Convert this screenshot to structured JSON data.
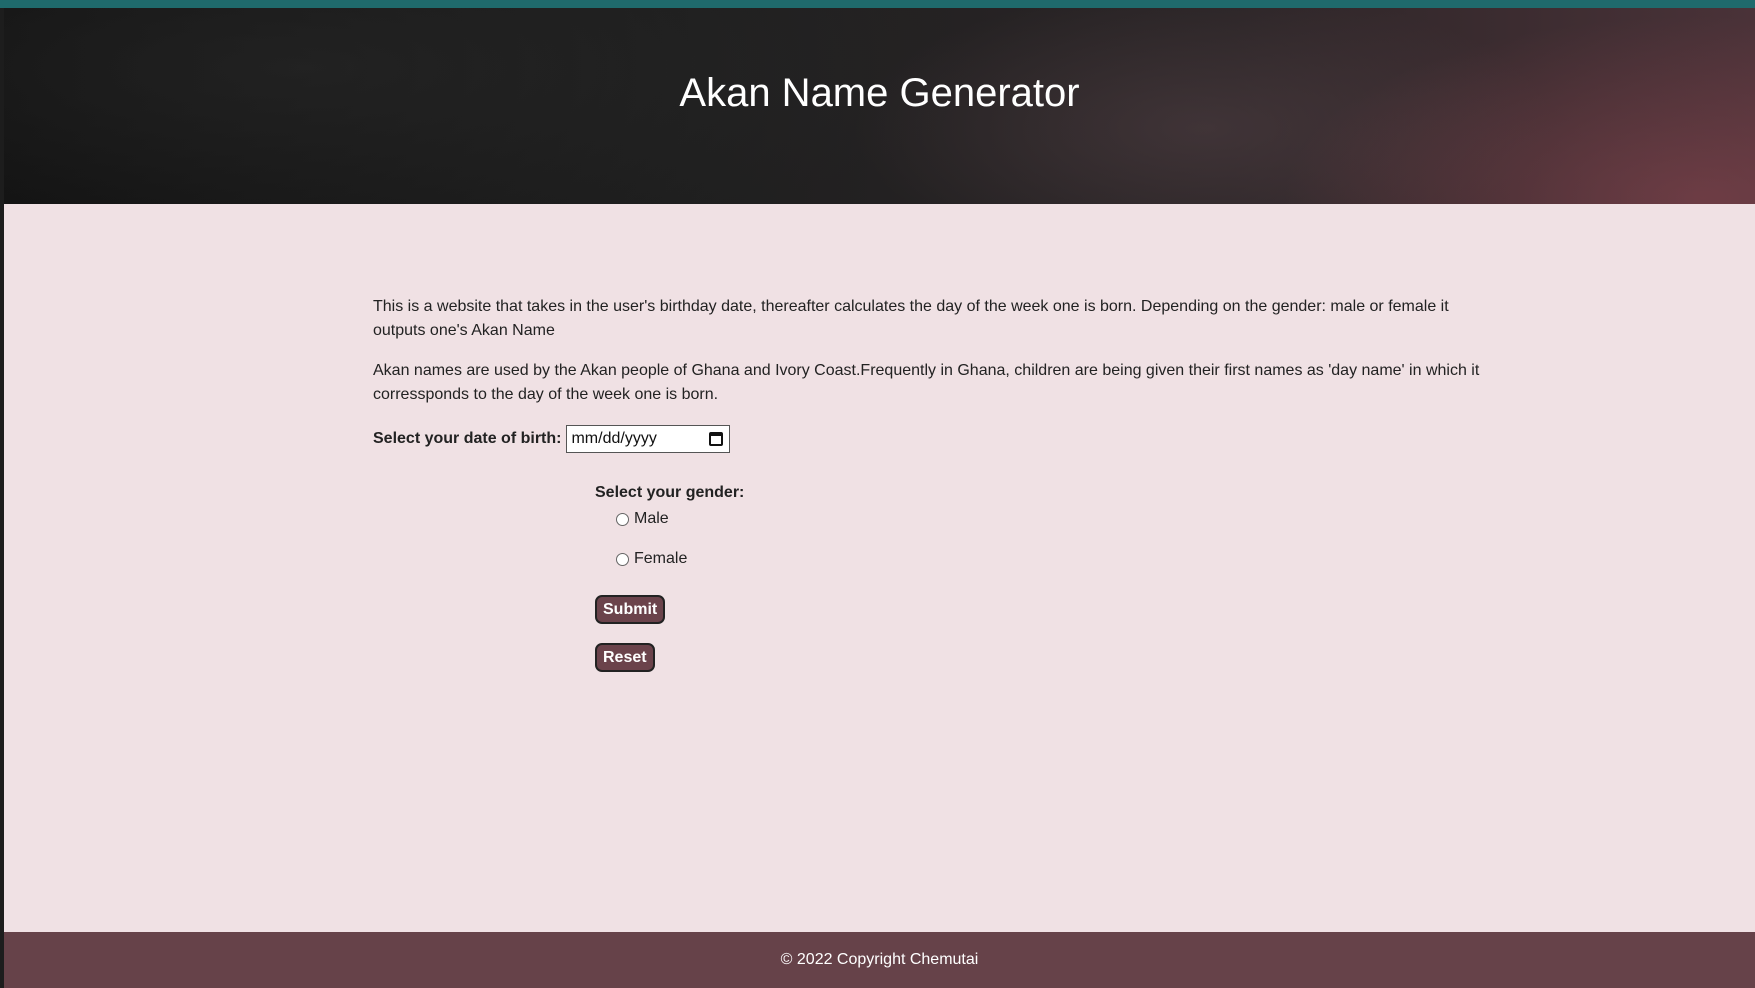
{
  "header": {
    "title": "Akan Name Generator"
  },
  "intro": {
    "paragraph_1": "This is a website that takes in the user's birthday date, thereafter calculates the day of the week one is born. Depending on the gender: male or female it outputs one's Akan Name",
    "paragraph_2": "Akan names are used by the Akan people of Ghana and Ivory Coast.Frequently in Ghana, children are being given their first names as 'day name' in which it corressponds to the day of the week one is born."
  },
  "form": {
    "dob_label": "Select your date of birth:",
    "dob_placeholder": "mm/dd/yyyy",
    "gender_label": "Select your gender:",
    "gender_options": [
      "Male",
      "Female"
    ],
    "submit_label": "Submit",
    "reset_label": "Reset"
  },
  "footer": {
    "text": "© 2022 Copyright Chemutai"
  },
  "colors": {
    "page_bg": "#f0e1e4",
    "button_bg": "#6b434b",
    "footer_bg": "#664249",
    "topbar": "#1f6a6c"
  }
}
